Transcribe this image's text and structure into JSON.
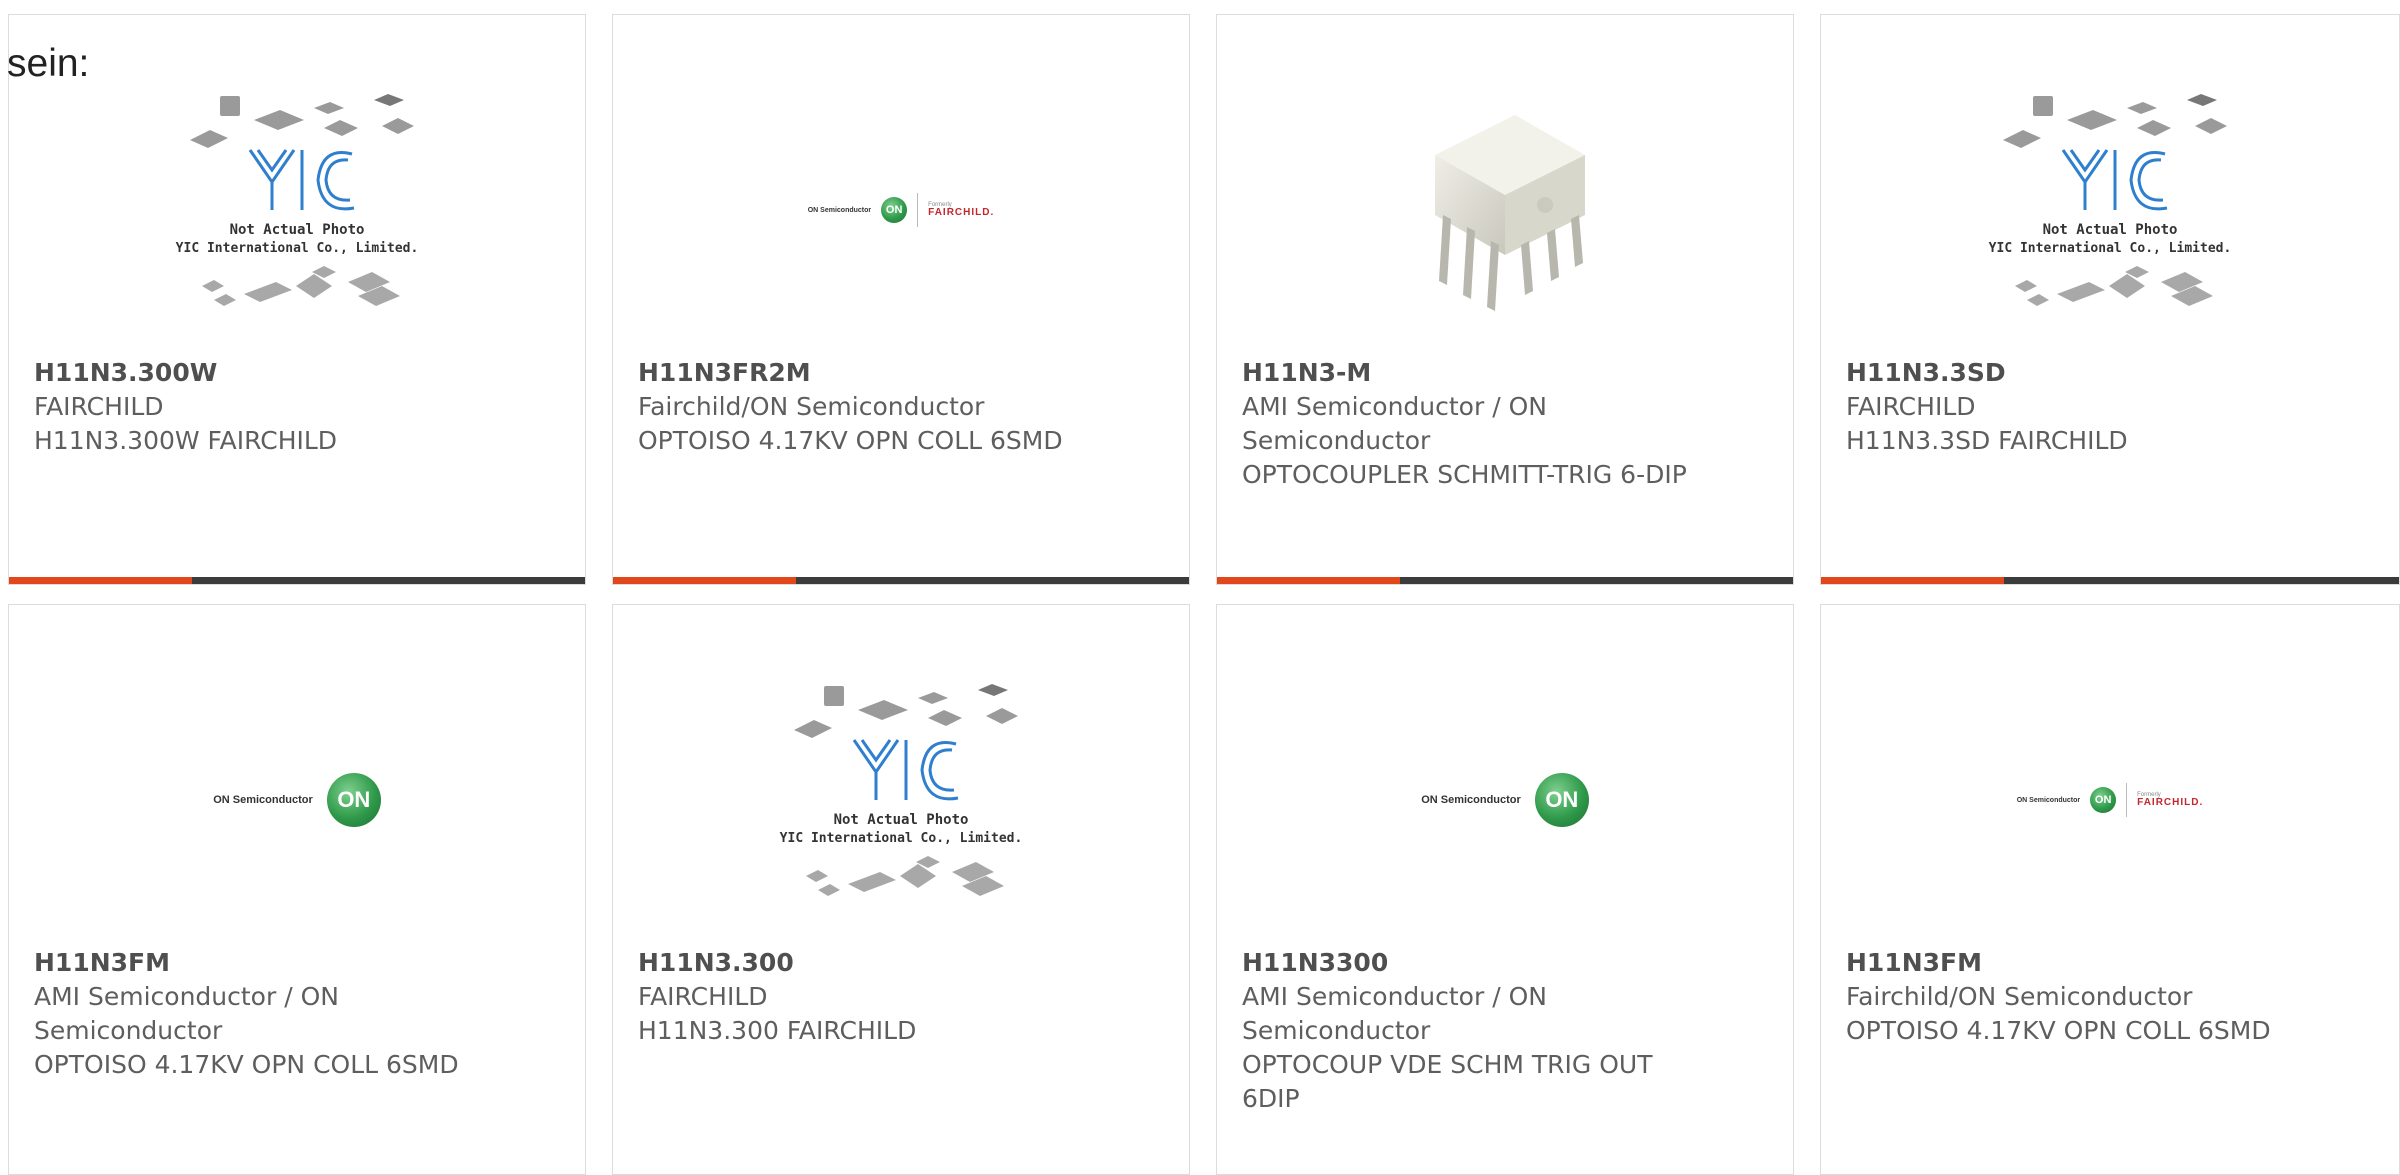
{
  "intro_text": "sein:",
  "placeholder": {
    "brand": "YIC",
    "line1": "Not Actual Photo",
    "line2": "YIC International Co., Limited."
  },
  "logos": {
    "on_semiconductor": "ON Semiconductor",
    "on_mark": "ON",
    "formerly": "Formerly",
    "fairchild": "FAIRCHILD."
  },
  "colors": {
    "accent": "#e2461b",
    "bar": "#3b3b3b",
    "on_green": "#2f9a4a",
    "fairchild_red": "#c4262e"
  },
  "products": [
    {
      "part_number": "H11N3.300W",
      "manufacturer": "FAIRCHILD",
      "description": "H11N3.300W FAIRCHILD",
      "image": "yic-placeholder"
    },
    {
      "part_number": "H11N3FR2M",
      "manufacturer": "Fairchild/ON Semiconductor",
      "description": "OPTOISO 4.17KV OPN COLL 6SMD",
      "image": "on-fairchild-logo"
    },
    {
      "part_number": "H11N3-M",
      "manufacturer": "AMI Semiconductor / ON Semiconductor",
      "description": "OPTOCOUPLER SCHMITT-TRIG 6-DIP",
      "image": "dip6-photo"
    },
    {
      "part_number": "H11N3.3SD",
      "manufacturer": "FAIRCHILD",
      "description": "H11N3.3SD FAIRCHILD",
      "image": "yic-placeholder"
    },
    {
      "part_number": "H11N3FM",
      "manufacturer": "AMI Semiconductor / ON Semiconductor",
      "description": "OPTOISO 4.17KV OPN COLL 6SMD",
      "image": "on-logo"
    },
    {
      "part_number": "H11N3.300",
      "manufacturer": "FAIRCHILD",
      "description": "H11N3.300 FAIRCHILD",
      "image": "yic-placeholder"
    },
    {
      "part_number": "H11N3300",
      "manufacturer": "AMI Semiconductor / ON Semiconductor",
      "description": "OPTOCOUP VDE SCHM TRIG OUT 6DIP",
      "image": "on-logo"
    },
    {
      "part_number": "H11N3FM",
      "manufacturer": "Fairchild/ON Semiconductor",
      "description": "OPTOISO 4.17KV OPN COLL 6SMD",
      "image": "on-fairchild-logo"
    }
  ]
}
